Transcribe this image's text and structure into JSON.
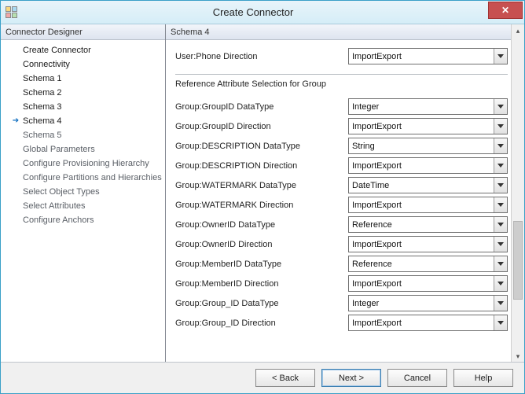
{
  "window": {
    "title": "Create Connector",
    "close_label": "✕"
  },
  "left": {
    "header": "Connector Designer",
    "items": [
      {
        "label": "Create Connector",
        "strong": true
      },
      {
        "label": "Connectivity",
        "strong": true
      },
      {
        "label": "Schema 1",
        "strong": true
      },
      {
        "label": "Schema 2",
        "strong": true
      },
      {
        "label": "Schema 3",
        "strong": true
      },
      {
        "label": "Schema 4",
        "strong": true,
        "current": true
      },
      {
        "label": "Schema 5"
      },
      {
        "label": "Global Parameters"
      },
      {
        "label": "Configure Provisioning Hierarchy"
      },
      {
        "label": "Configure Partitions and Hierarchies"
      },
      {
        "label": "Select Object Types"
      },
      {
        "label": "Select Attributes"
      },
      {
        "label": "Configure Anchors"
      }
    ]
  },
  "right": {
    "header": "Schema 4",
    "top_row": {
      "label": "User:Phone Direction",
      "value": "ImportExport"
    },
    "section_label": "Reference Attribute Selection for Group",
    "rows": [
      {
        "label": "Group:GroupID DataType",
        "value": "Integer"
      },
      {
        "label": "Group:GroupID Direction",
        "value": "ImportExport"
      },
      {
        "label": "Group:DESCRIPTION DataType",
        "value": "String"
      },
      {
        "label": "Group:DESCRIPTION Direction",
        "value": "ImportExport"
      },
      {
        "label": "Group:WATERMARK DataType",
        "value": "DateTime"
      },
      {
        "label": "Group:WATERMARK Direction",
        "value": "ImportExport"
      },
      {
        "label": "Group:OwnerID DataType",
        "value": "Reference"
      },
      {
        "label": "Group:OwnerID Direction",
        "value": "ImportExport"
      },
      {
        "label": "Group:MemberID DataType",
        "value": "Reference"
      },
      {
        "label": "Group:MemberID Direction",
        "value": "ImportExport"
      },
      {
        "label": "Group:Group_ID DataType",
        "value": "Integer"
      },
      {
        "label": "Group:Group_ID Direction",
        "value": "ImportExport"
      }
    ]
  },
  "buttons": {
    "back": "<  Back",
    "next": "Next  >",
    "cancel": "Cancel",
    "help": "Help"
  }
}
